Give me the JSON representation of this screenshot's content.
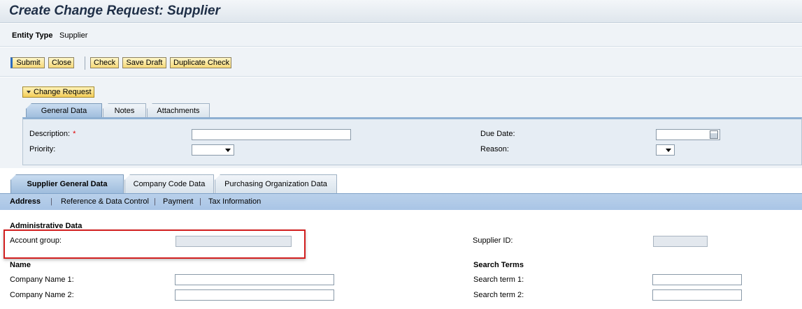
{
  "page": {
    "title": "Create Change Request: Supplier"
  },
  "entity": {
    "label": "Entity Type",
    "value": "Supplier"
  },
  "toolbar": {
    "submit": "Submit",
    "close": "Close",
    "check": "Check",
    "save_draft": "Save Draft",
    "duplicate_check": "Duplicate Check"
  },
  "change_request": {
    "toggle_label": "Change Request",
    "tabs": [
      "General Data",
      "Notes",
      "Attachments"
    ],
    "fields": {
      "description_label": "Description:",
      "required_mark": "*",
      "priority_label": "Priority:",
      "due_date_label": "Due Date:",
      "reason_label": "Reason:"
    }
  },
  "main_tabs": [
    "Supplier General Data",
    "Company Code Data",
    "Purchasing Organization Data"
  ],
  "subnav": [
    "Address",
    "Reference & Data Control",
    "Payment",
    "Tax Information"
  ],
  "admin": {
    "title": "Administrative Data",
    "account_group_label": "Account group:",
    "supplier_id_label": "Supplier ID:"
  },
  "name_section": {
    "title": "Name",
    "company_name_1": "Company Name 1:",
    "company_name_2": "Company Name 2:"
  },
  "search_terms": {
    "title": "Search Terms",
    "term_1": "Search term 1:",
    "term_2": "Search term 2:"
  },
  "colors": {
    "highlight": "#d21f1f",
    "active_tab": "#9fbddd",
    "button": "#f6d978"
  }
}
